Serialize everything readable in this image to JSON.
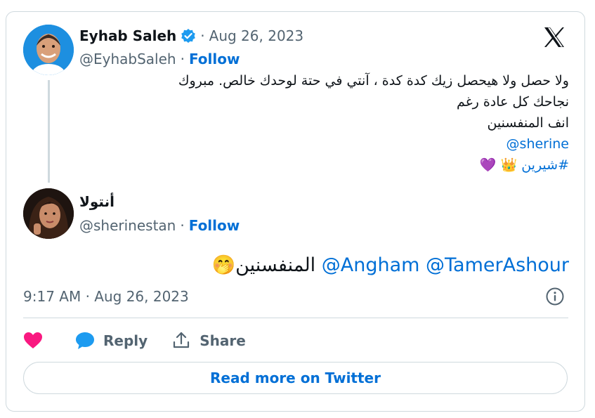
{
  "tweet_quoted": {
    "display_name": "Eyhab Saleh",
    "handle": "@EyhabSaleh",
    "follow_label": "Follow",
    "separator": "·",
    "date": "Aug 26, 2023",
    "lines": [
      "ولا حصل ولا هيحصل زيك كدة كدة ، آنتي في حتة لوحدك خالص. مبروك",
      "نجاحك كل عادة رغم",
      "انف المنفسنين"
    ],
    "mention": "@sherine",
    "hashtag": "#شيرين",
    "emojis": "👑 💜"
  },
  "tweet_main": {
    "display_name": "أنتولا",
    "handle": "@sherinestan",
    "follow_label": "Follow",
    "separator": "·",
    "mentions": "@Angham @TamerAshour",
    "text": "المنفسنين",
    "emoji": "🤭",
    "timestamp": "9:17 AM · Aug 26, 2023"
  },
  "actions": {
    "reply_label": "Reply",
    "share_label": "Share"
  },
  "read_more_label": "Read more on Twitter",
  "colors": {
    "link": "#006fd6",
    "verified": "#1d9bf0",
    "like": "#f91880",
    "muted": "#536471",
    "border": "#cfd9de"
  },
  "icons": [
    "verified-badge-icon",
    "x-logo-icon",
    "info-icon",
    "heart-icon",
    "reply-bubble-icon",
    "share-upload-icon"
  ]
}
